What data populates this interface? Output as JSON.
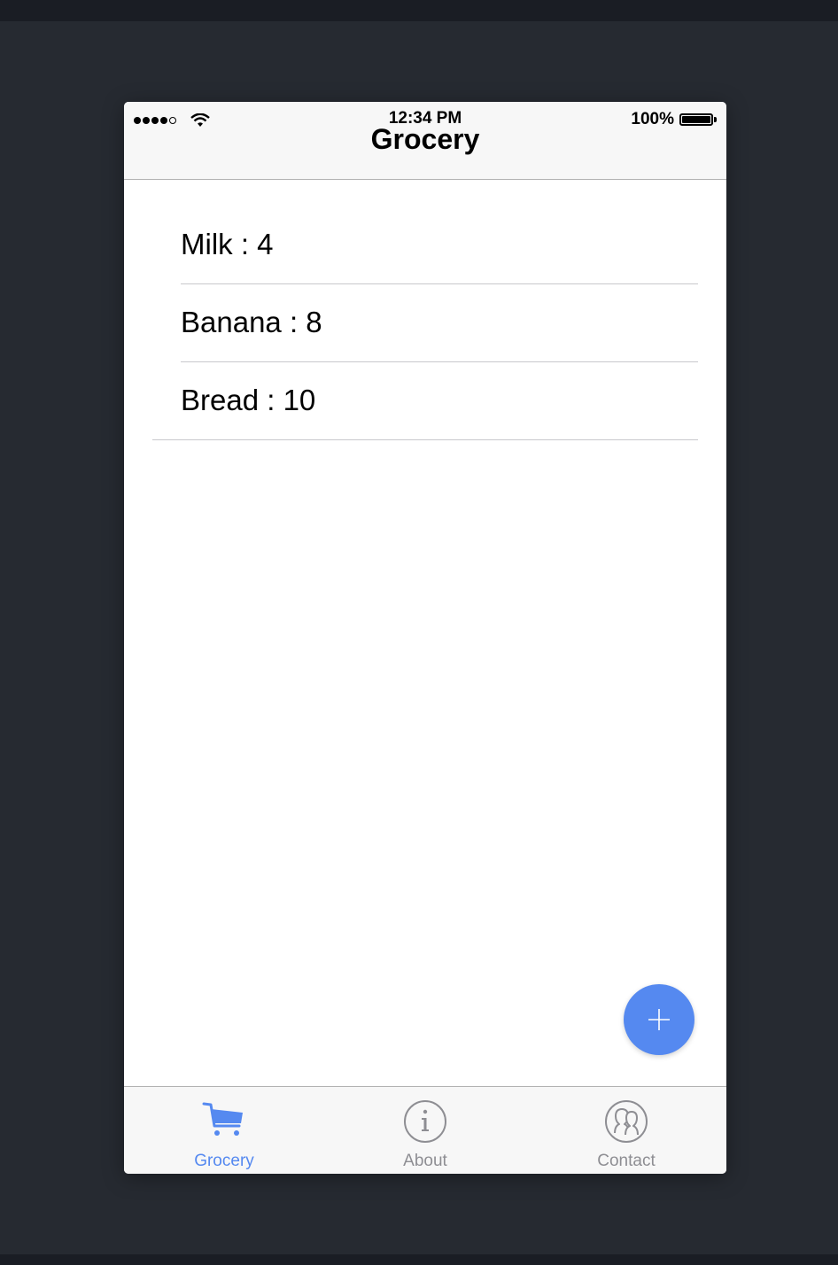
{
  "status_bar": {
    "time": "12:34 PM",
    "battery_percent": "100%",
    "signal_bars_filled": 4,
    "signal_bars_total": 5,
    "battery_level": 1.0
  },
  "navbar": {
    "title": "Grocery"
  },
  "grocery_list": [
    {
      "text": "Milk : 4"
    },
    {
      "text": "Banana : 8"
    },
    {
      "text": "Bread : 10"
    }
  ],
  "fab": {
    "icon": "plus-icon",
    "color": "#5589f0"
  },
  "tabbar": {
    "tabs": [
      {
        "label": "Grocery",
        "icon": "cart-icon",
        "active": true
      },
      {
        "label": "About",
        "icon": "info-icon",
        "active": false
      },
      {
        "label": "Contact",
        "icon": "contacts-icon",
        "active": false
      }
    ],
    "active_color": "#5589f0",
    "inactive_color": "#8e8e93"
  }
}
